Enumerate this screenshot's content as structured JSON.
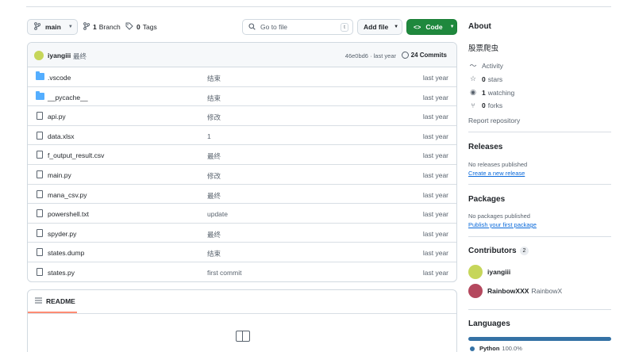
{
  "toolbar": {
    "branch": "main",
    "branch_count": "1",
    "branch_label": "Branch",
    "tag_count": "0",
    "tag_label": "Tags",
    "goto_placeholder": "Go to file",
    "goto_shortcut": "t",
    "add_file": "Add file",
    "code": "Code"
  },
  "commit": {
    "user": "iyangiii",
    "message": "最终",
    "hash_date": "46e0bd6 · last year",
    "count": "24 Commits"
  },
  "files": [
    {
      "name": ".vscode",
      "type": "folder",
      "message": "结束",
      "date": "last year"
    },
    {
      "name": "__pycache__",
      "type": "folder",
      "message": "结束",
      "date": "last year"
    },
    {
      "name": "api.py",
      "type": "file",
      "message": "修改",
      "date": "last year"
    },
    {
      "name": "data.xlsx",
      "type": "file",
      "message": "1",
      "date": "last year"
    },
    {
      "name": "f_output_result.csv",
      "type": "file",
      "message": "最终",
      "date": "last year"
    },
    {
      "name": "main.py",
      "type": "file",
      "message": "修改",
      "date": "last year"
    },
    {
      "name": "mana_csv.py",
      "type": "file",
      "message": "最终",
      "date": "last year"
    },
    {
      "name": "powershell.txt",
      "type": "file",
      "message": "update",
      "date": "last year"
    },
    {
      "name": "spyder.py",
      "type": "file",
      "message": "最终",
      "date": "last year"
    },
    {
      "name": "states.dump",
      "type": "file",
      "message": "结束",
      "date": "last year"
    },
    {
      "name": "states.py",
      "type": "file",
      "message": "first commit",
      "date": "last year"
    }
  ],
  "readme": {
    "tab": "README"
  },
  "about": {
    "title": "About",
    "description": "股票爬虫",
    "activity": "Activity",
    "stars_count": "0",
    "stars_label": "stars",
    "watching_count": "1",
    "watching_label": "watching",
    "forks_count": "0",
    "forks_label": "forks",
    "report": "Report repository"
  },
  "releases": {
    "title": "Releases",
    "none": "No releases published",
    "create": "Create a new release"
  },
  "packages": {
    "title": "Packages",
    "none": "No packages published",
    "publish": "Publish your first package"
  },
  "contributors": {
    "title": "Contributors",
    "count": "2",
    "people": [
      {
        "login": "iyangiii",
        "name": "",
        "color": "#c6d65a"
      },
      {
        "login": "RainbowXXX",
        "name": "RainbowX",
        "color": "#b4485e"
      }
    ]
  },
  "languages": {
    "title": "Languages",
    "name": "Python",
    "percent": "100.0%",
    "color": "#3572a5"
  }
}
